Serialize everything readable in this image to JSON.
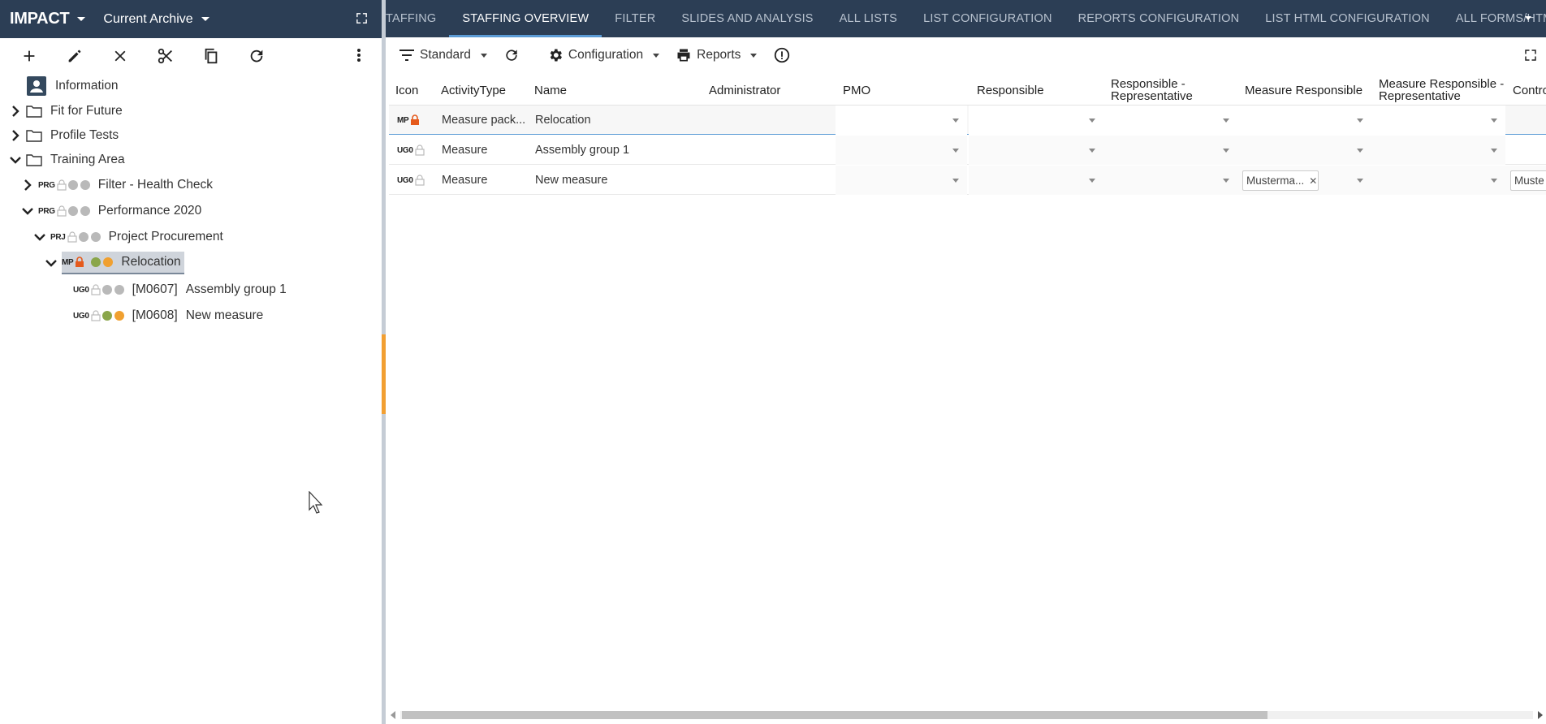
{
  "left_header": {
    "brand": "IMPACT",
    "archive": "Current Archive"
  },
  "left_toolbar": {
    "buttons": [
      "add-icon",
      "edit-icon",
      "close-icon",
      "cut-icon",
      "copy-icon",
      "refresh-icon"
    ],
    "more": "more-vert-icon"
  },
  "tree": {
    "information": "Information",
    "fit_for_future": "Fit for Future",
    "profile_tests": "Profile Tests",
    "training_area": "Training Area",
    "filter_health_check": {
      "badge": "PRG",
      "label": "Filter - Health Check"
    },
    "performance_2020": {
      "badge": "PRG",
      "label": "Performance 2020"
    },
    "project_procurement": {
      "badge": "PRJ",
      "label": "Project Procurement"
    },
    "relocation": {
      "badge": "MP",
      "label": "Relocation"
    },
    "assembly_group": {
      "badge": "UG0",
      "code": "[M0607]",
      "label": "Assembly group 1"
    },
    "new_measure": {
      "badge": "UG0",
      "code": "[M0608]",
      "label": "New measure"
    }
  },
  "colors": {
    "header_bg": "#2c3e55",
    "accent_orange": "#f29f32",
    "lock_red": "#e55a1c",
    "dot_green": "#8aa64a",
    "dot_orange": "#f0a030",
    "dot_grey": "#b9b9b9",
    "active_tab": "#5b9bd5"
  },
  "tabs": [
    "TAFFING",
    "STAFFING OVERVIEW",
    "FILTER",
    "SLIDES AND ANALYSIS",
    "ALL LISTS",
    "LIST CONFIGURATION",
    "REPORTS CONFIGURATION",
    "LIST HTML CONFIGURATION",
    "ALL FORMS/HTML"
  ],
  "right_toolbar": {
    "standard": "Standard",
    "configuration": "Configuration",
    "reports": "Reports"
  },
  "grid": {
    "headers": {
      "icon": "Icon",
      "activity_type": "ActivityType",
      "name": "Name",
      "administrator": "Administrator",
      "pmo": "PMO",
      "responsible": "Responsible",
      "responsible_rep_1": "Responsible -",
      "responsible_rep_2": "Representative",
      "measure_responsible": "Measure Responsible",
      "measure_resp_rep_1": "Measure Responsible -",
      "measure_resp_rep_2": "Representative",
      "controller": "Contro"
    },
    "rows": [
      {
        "badge": "MP",
        "activity_type": "Measure pack...",
        "name": "Relocation"
      },
      {
        "badge": "UG0",
        "activity_type": "Measure",
        "name": "Assembly group 1"
      },
      {
        "badge": "UG0",
        "activity_type": "Measure",
        "name": "New measure",
        "measure_responsible": "Musterma...",
        "controller": "Muste"
      }
    ]
  }
}
